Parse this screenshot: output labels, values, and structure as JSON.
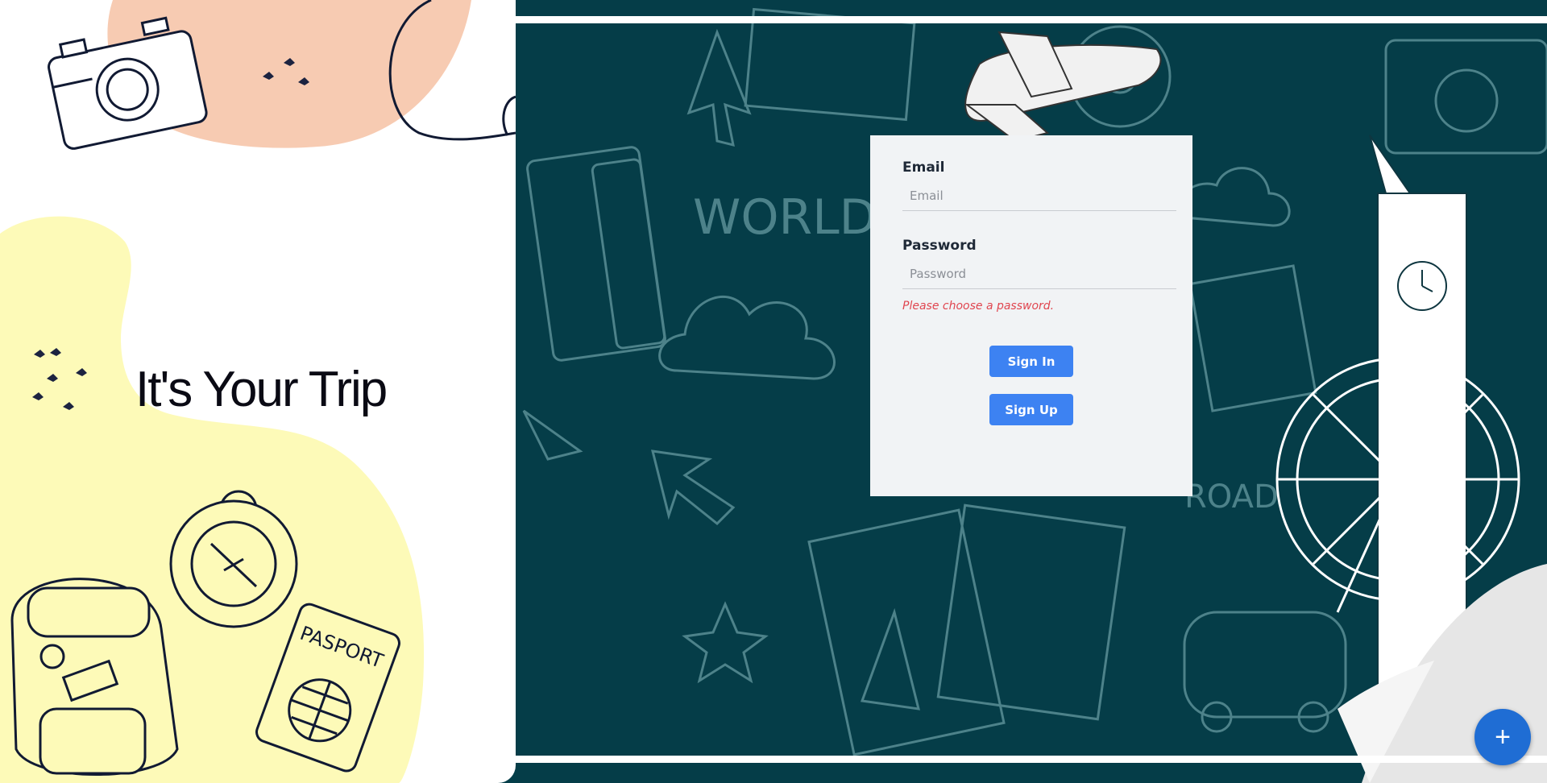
{
  "hero": {
    "title": "It's Your Trip"
  },
  "login": {
    "email_label": "Email",
    "email_placeholder": "Email",
    "password_label": "Password",
    "password_placeholder": "Password",
    "error": "Please choose a password.",
    "sign_in": "Sign In",
    "sign_up": "Sign Up"
  },
  "background_words": [
    "WORLD",
    "ROAD"
  ],
  "fab": {
    "icon": "plus-icon",
    "symbol": "+"
  },
  "colors": {
    "teal_background": "#053d48",
    "card": "#f1f3f5",
    "button": "#3d82f2",
    "error": "#e0454f",
    "peach_blob": "#f7cbb2",
    "yellow_blob": "#fdfab8",
    "fab": "#1f6dd4"
  }
}
